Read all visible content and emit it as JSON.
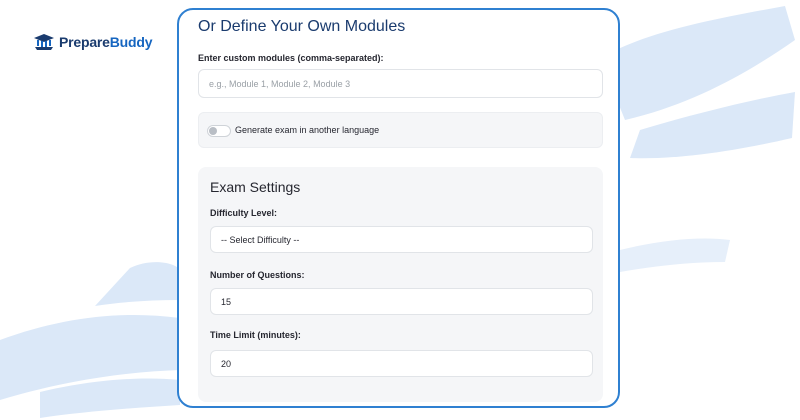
{
  "brand": {
    "prefix": "Prepare",
    "suffix": "Buddy"
  },
  "custom_modules": {
    "title": "Or Define Your Own Modules",
    "label": "Enter custom modules (comma-separated):",
    "placeholder": "e.g., Module 1, Module 2, Module 3",
    "value": ""
  },
  "language_toggle": {
    "label": "Generate exam in another language",
    "checked": false
  },
  "exam_settings": {
    "title": "Exam Settings",
    "difficulty": {
      "label": "Difficulty Level:",
      "selected": "-- Select Difficulty --"
    },
    "questions": {
      "label": "Number of Questions:",
      "value": "15"
    },
    "time_limit": {
      "label": "Time Limit (minutes):",
      "value": "20"
    }
  },
  "colors": {
    "card_border": "#2f80d1",
    "brand_dark": "#1a3b6e",
    "brand_blue": "#1565c0",
    "brush_stroke": "#dbe8f8",
    "panel_bg": "#f5f6f8"
  }
}
